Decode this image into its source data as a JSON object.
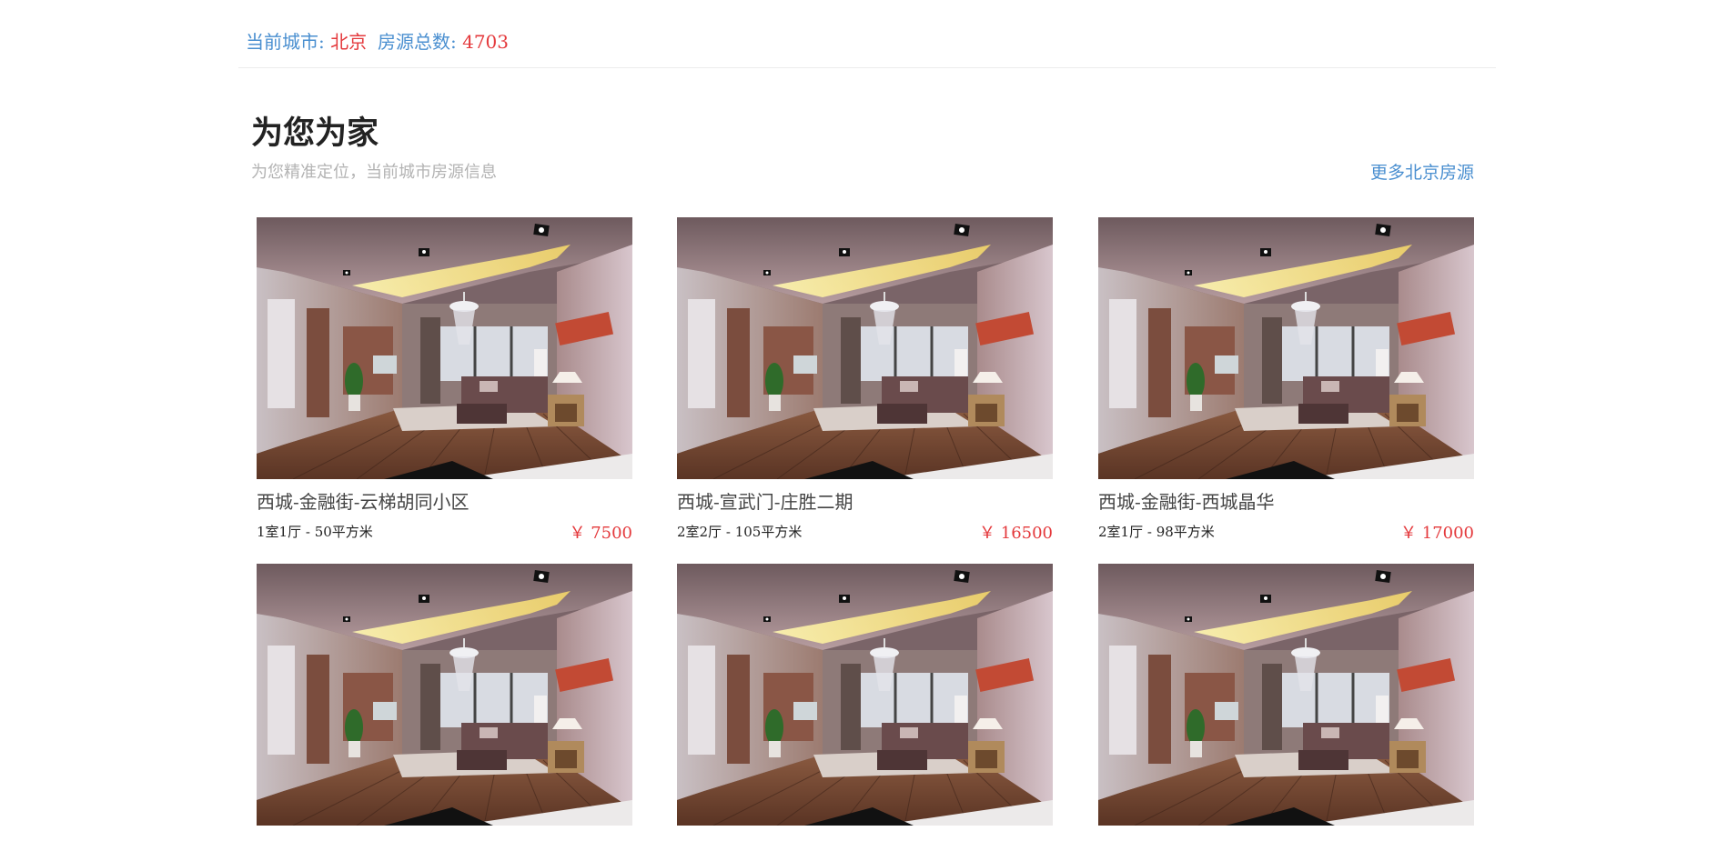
{
  "header": {
    "city_label": "当前城市:",
    "city_value": "北京",
    "count_label": "房源总数:",
    "count_value": "4703"
  },
  "section": {
    "title": "为您为家",
    "subtitle": "为您精准定位，当前城市房源信息",
    "more_link": "更多北京房源"
  },
  "listings": [
    {
      "name": "西城-金融街-云梯胡同小区",
      "specs": "1室1厅 - 50平方米",
      "price": "￥ 7500"
    },
    {
      "name": "西城-宣武门-庄胜二期",
      "specs": "2室2厅 - 105平方米",
      "price": "￥ 16500"
    },
    {
      "name": "西城-金融街-西城晶华",
      "specs": "2室1厅 - 98平方米",
      "price": "￥ 17000"
    },
    {
      "name": "",
      "specs": "",
      "price": ""
    },
    {
      "name": "",
      "specs": "",
      "price": ""
    },
    {
      "name": "",
      "specs": "",
      "price": ""
    }
  ],
  "colors": {
    "link_blue": "#4a8fd0",
    "price_red": "#e4393c",
    "title_dark": "#222222",
    "subtitle_gray": "#b3b3b3"
  }
}
